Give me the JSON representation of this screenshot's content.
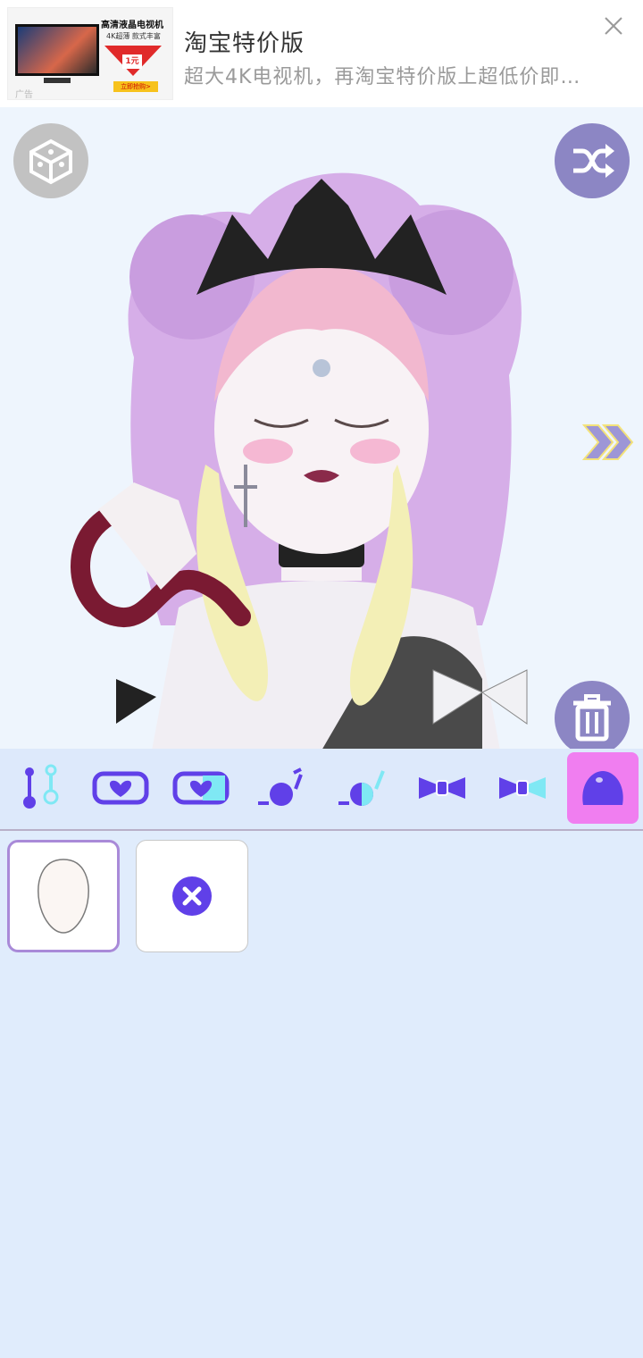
{
  "ad": {
    "thumb_title": "高清液晶电视机",
    "thumb_sub": "4K超薄 款式丰富",
    "thumb_price": "1元",
    "thumb_buy": "立即抢购>",
    "ad_tag": "广告",
    "title": "淘宝特价版",
    "description": "超大4K电视机，再淘宝特价版上超低价即…"
  },
  "stage": {
    "icons": [
      "dice-icon",
      "shuffle-icon",
      "double-chevron-right-icon",
      "trash-icon"
    ]
  },
  "categories": [
    {
      "name": "earring-icon"
    },
    {
      "name": "heart-frame-icon"
    },
    {
      "name": "heart-frame-half-icon"
    },
    {
      "name": "ball-stick-icon"
    },
    {
      "name": "ball-stick-half-icon"
    },
    {
      "name": "bow-icon"
    },
    {
      "name": "bow-half-icon"
    },
    {
      "name": "blob-icon",
      "active": true
    }
  ],
  "items": [
    {
      "name": "face-shape-item",
      "selected": true
    },
    {
      "name": "none-item",
      "selected": false
    }
  ],
  "colors": {
    "accent_purple": "#6040e8",
    "button_purple": "#8c86c4",
    "active_tab": "#f07ef0",
    "background": "#e0ecfc"
  }
}
